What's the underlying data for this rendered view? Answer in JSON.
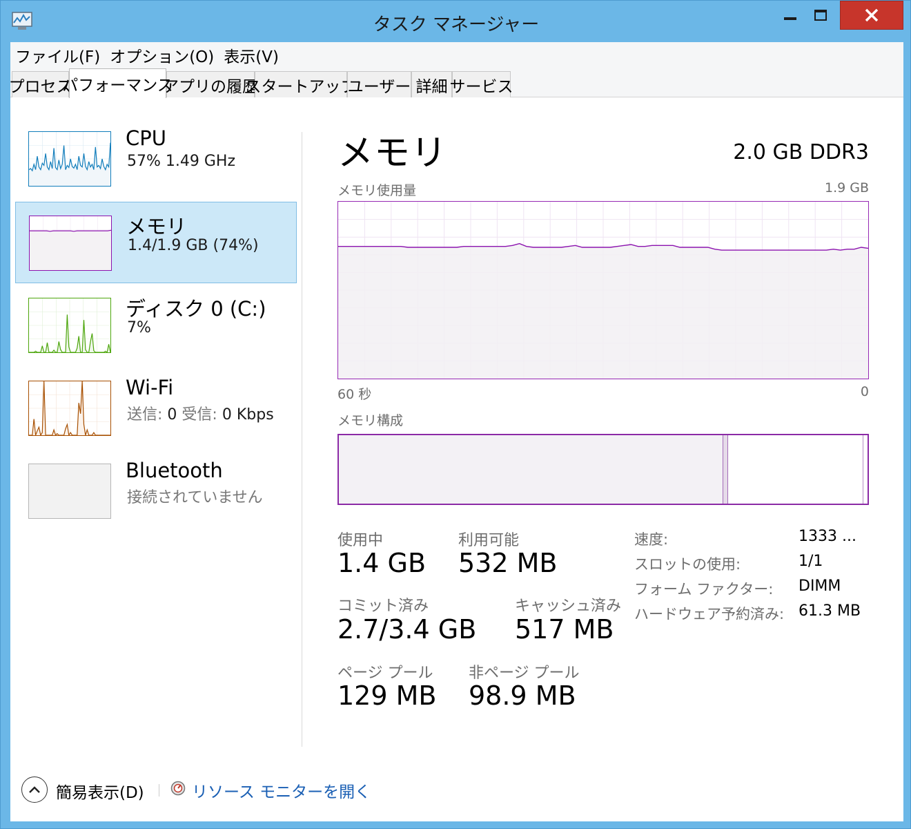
{
  "window": {
    "title": "タスク マネージャー"
  },
  "menu": [
    "ファイル(F)",
    "オプション(O)",
    "表示(V)"
  ],
  "tabs": [
    "プロセス",
    "パフォーマンス",
    "アプリの履歴",
    "スタートアップ",
    "ユーザー",
    "詳細",
    "サービス"
  ],
  "active_tab": "パフォーマンス",
  "sidebar": {
    "items": [
      {
        "title": "CPU",
        "subtitle": "57%  1.49 GHz"
      },
      {
        "title": "メモリ",
        "subtitle": "1.4/1.9 GB (74%)"
      },
      {
        "title": "ディスク 0 (C:)",
        "subtitle": "7%"
      },
      {
        "title": "Wi-Fi",
        "subtitle_label_send": "送信:",
        "subtitle_send": "0",
        "subtitle_label_recv": "受信:",
        "subtitle_recv": "0 Kbps"
      },
      {
        "title": "Bluetooth",
        "subtitle": "接続されていません"
      }
    ],
    "selected": "メモリ"
  },
  "memory": {
    "title": "メモリ",
    "spec": "2.0 GB DDR3",
    "usage_label": "メモリ使用量",
    "usage_max": "1.9 GB",
    "axis_left": "60 秒",
    "axis_right": "0",
    "composition_label": "メモリ構成",
    "composition": {
      "in_use_fraction": 0.727,
      "modified_fraction": 0.009,
      "standby_fraction": 0.255
    },
    "stats": {
      "in_use_label": "使用中",
      "in_use": "1.4 GB",
      "available_label": "利用可能",
      "available": "532 MB",
      "committed_label": "コミット済み",
      "committed": "2.7/3.4 GB",
      "cached_label": "キャッシュ済み",
      "cached": "517 MB",
      "paged_label": "ページ プール",
      "paged": "129 MB",
      "nonpaged_label": "非ページ プール",
      "nonpaged": "98.9 MB"
    },
    "details": [
      {
        "label": "速度:",
        "value": "1333 ..."
      },
      {
        "label": "スロットの使用:",
        "value": "1/1"
      },
      {
        "label": "フォーム ファクター:",
        "value": "DIMM"
      },
      {
        "label": "ハードウェア予約済み:",
        "value": "61.3 MB"
      }
    ],
    "usage_series_gb": [
      1.42,
      1.42,
      1.42,
      1.42,
      1.42,
      1.42,
      1.42,
      1.42,
      1.42,
      1.42,
      1.41,
      1.41,
      1.41,
      1.41,
      1.41,
      1.41,
      1.41,
      1.41,
      1.42,
      1.42,
      1.42,
      1.42,
      1.42,
      1.42,
      1.42,
      1.43,
      1.45,
      1.42,
      1.41,
      1.41,
      1.41,
      1.41,
      1.41,
      1.42,
      1.43,
      1.41,
      1.41,
      1.41,
      1.41,
      1.41,
      1.42,
      1.43,
      1.44,
      1.42,
      1.42,
      1.43,
      1.43,
      1.43,
      1.43,
      1.41,
      1.41,
      1.41,
      1.41,
      1.41,
      1.39,
      1.38,
      1.38,
      1.38,
      1.38,
      1.38,
      1.38,
      1.38,
      1.38,
      1.38,
      1.38,
      1.38,
      1.38,
      1.38,
      1.38,
      1.38,
      1.38,
      1.39,
      1.38,
      1.39,
      1.39,
      1.41,
      1.4
    ]
  },
  "thumbnails": {
    "cpu": [
      30,
      32,
      28,
      40,
      30,
      55,
      35,
      30,
      42,
      38,
      60,
      35,
      30,
      45,
      32,
      70,
      34,
      30,
      48,
      32,
      40,
      75,
      30,
      38,
      34,
      50,
      36,
      33,
      40,
      30,
      55,
      38,
      35,
      60,
      36,
      30,
      45,
      35,
      40,
      30,
      72,
      35,
      38,
      32,
      50,
      36,
      30,
      40,
      35,
      80
    ],
    "memory": [
      73,
      73,
      73,
      73,
      73,
      73,
      72,
      73,
      73,
      73,
      73,
      73,
      73,
      72,
      73,
      73,
      73,
      73,
      73,
      73,
      73,
      73,
      73,
      73,
      74
    ],
    "disk": [
      0,
      0,
      0,
      0,
      2,
      0,
      0,
      0,
      12,
      0,
      0,
      18,
      0,
      0,
      0,
      4,
      0,
      0,
      20,
      5,
      0,
      0,
      0,
      70,
      10,
      0,
      0,
      0,
      0,
      8,
      30,
      0,
      0,
      60,
      5,
      0,
      0,
      20,
      35,
      3,
      0,
      0,
      0,
      0,
      0,
      0,
      2,
      0,
      15,
      0
    ],
    "wifi": [
      0,
      0,
      0,
      30,
      0,
      8,
      15,
      0,
      5,
      100,
      0,
      0,
      0,
      0,
      0,
      10,
      0,
      3,
      0,
      0,
      0,
      0,
      12,
      20,
      0,
      5,
      0,
      0,
      0,
      0,
      60,
      40,
      100,
      20,
      0,
      10,
      0,
      0,
      0,
      5,
      0,
      0,
      0,
      0,
      0,
      0,
      0,
      0,
      0,
      0
    ]
  },
  "footer": {
    "fewer_details": "簡易表示(D)",
    "resource_monitor": "リソース モニターを開く"
  },
  "colors": {
    "accent": "#9528b4",
    "cpu": "#117dbb",
    "memory": "#8b12ae",
    "disk": "#4da60c",
    "wifi": "#a74f01",
    "selection": "#cce8f8",
    "close": "#c7352b"
  }
}
